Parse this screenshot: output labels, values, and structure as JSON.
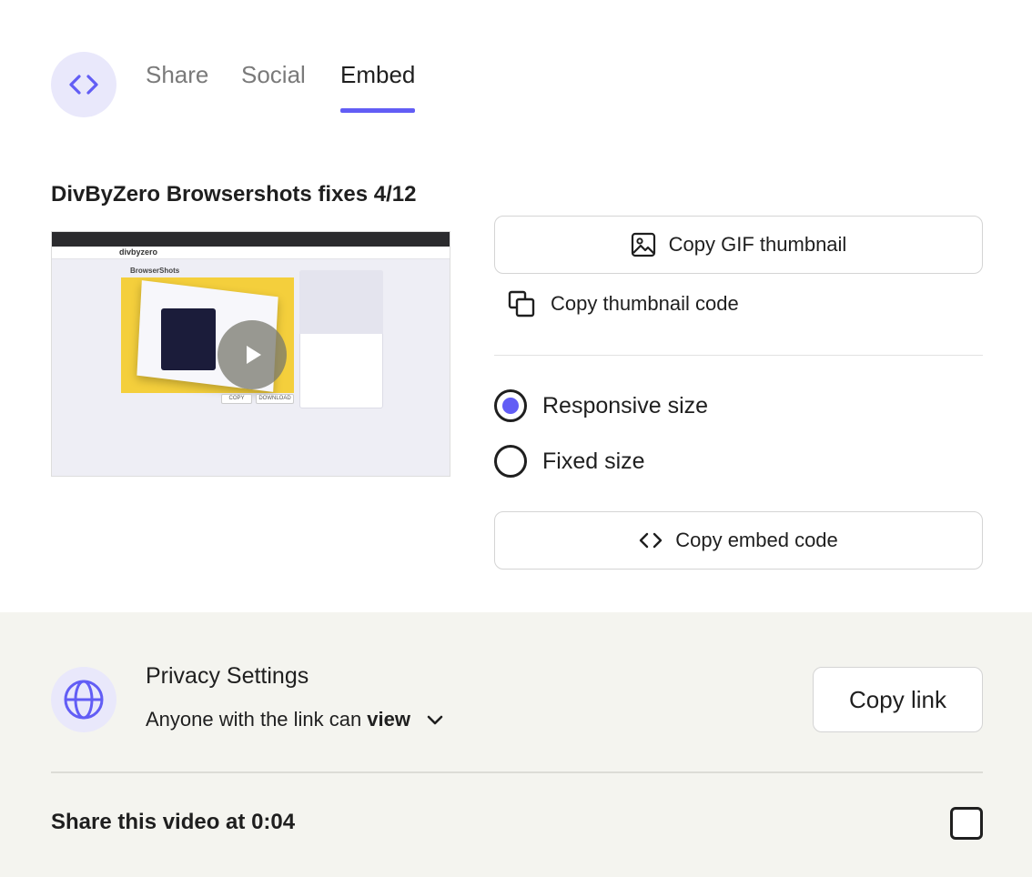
{
  "tabs": [
    {
      "label": "Share",
      "active": false
    },
    {
      "label": "Social",
      "active": false
    },
    {
      "label": "Embed",
      "active": true
    }
  ],
  "header": {
    "icon": "code-brackets-icon"
  },
  "video": {
    "title": "DivByZero Browsershots fixes 4/12",
    "thumbnail": {
      "app_logo": "divbyzero",
      "page_title": "BrowserShots",
      "copy_label": "COPY",
      "download_label": "DOWNLOAD"
    }
  },
  "actions": {
    "copy_gif_thumbnail": "Copy GIF thumbnail",
    "copy_thumbnail_code": "Copy thumbnail code",
    "copy_embed_code": "Copy embed code"
  },
  "size_options": [
    {
      "label": "Responsive size",
      "selected": true
    },
    {
      "label": "Fixed size",
      "selected": false
    }
  ],
  "privacy": {
    "title": "Privacy Settings",
    "prefix": "Anyone with the link can",
    "permission": "view",
    "copy_link": "Copy link"
  },
  "share_at_time": {
    "label": "Share this video at 0:04",
    "checked": false
  },
  "colors": {
    "accent": "#625df5",
    "icon_bg": "#e9e8fb",
    "bottom_bg": "#f4f4ef"
  }
}
